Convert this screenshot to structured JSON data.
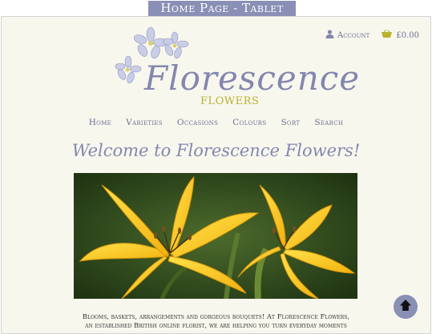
{
  "page_label": "Home Page - Tablet",
  "header": {
    "account_label": "Account",
    "basket_total": "£0.00",
    "brand_name": "Florescence",
    "brand_sub": "FLOWERS"
  },
  "nav": [
    "Home",
    "Varieties",
    "Occasions",
    "Colours",
    "Sort",
    "Search"
  ],
  "welcome": "Welcome to Florescence Flowers!",
  "intro_line1": "Blooms, baskets, arrangements and gorgeous bouquets! At Florescence Flowers,",
  "intro_line2": "an established British online florist, we are helping you turn everyday moments",
  "icons": {
    "account": "user-icon",
    "basket": "basket-icon",
    "back_to_top": "arrow-up-icon"
  },
  "colors": {
    "accent": "#8a8fb5",
    "brand_text": "#8387ae",
    "brand_sub": "#b8b22d",
    "background": "#f8f7ee"
  }
}
